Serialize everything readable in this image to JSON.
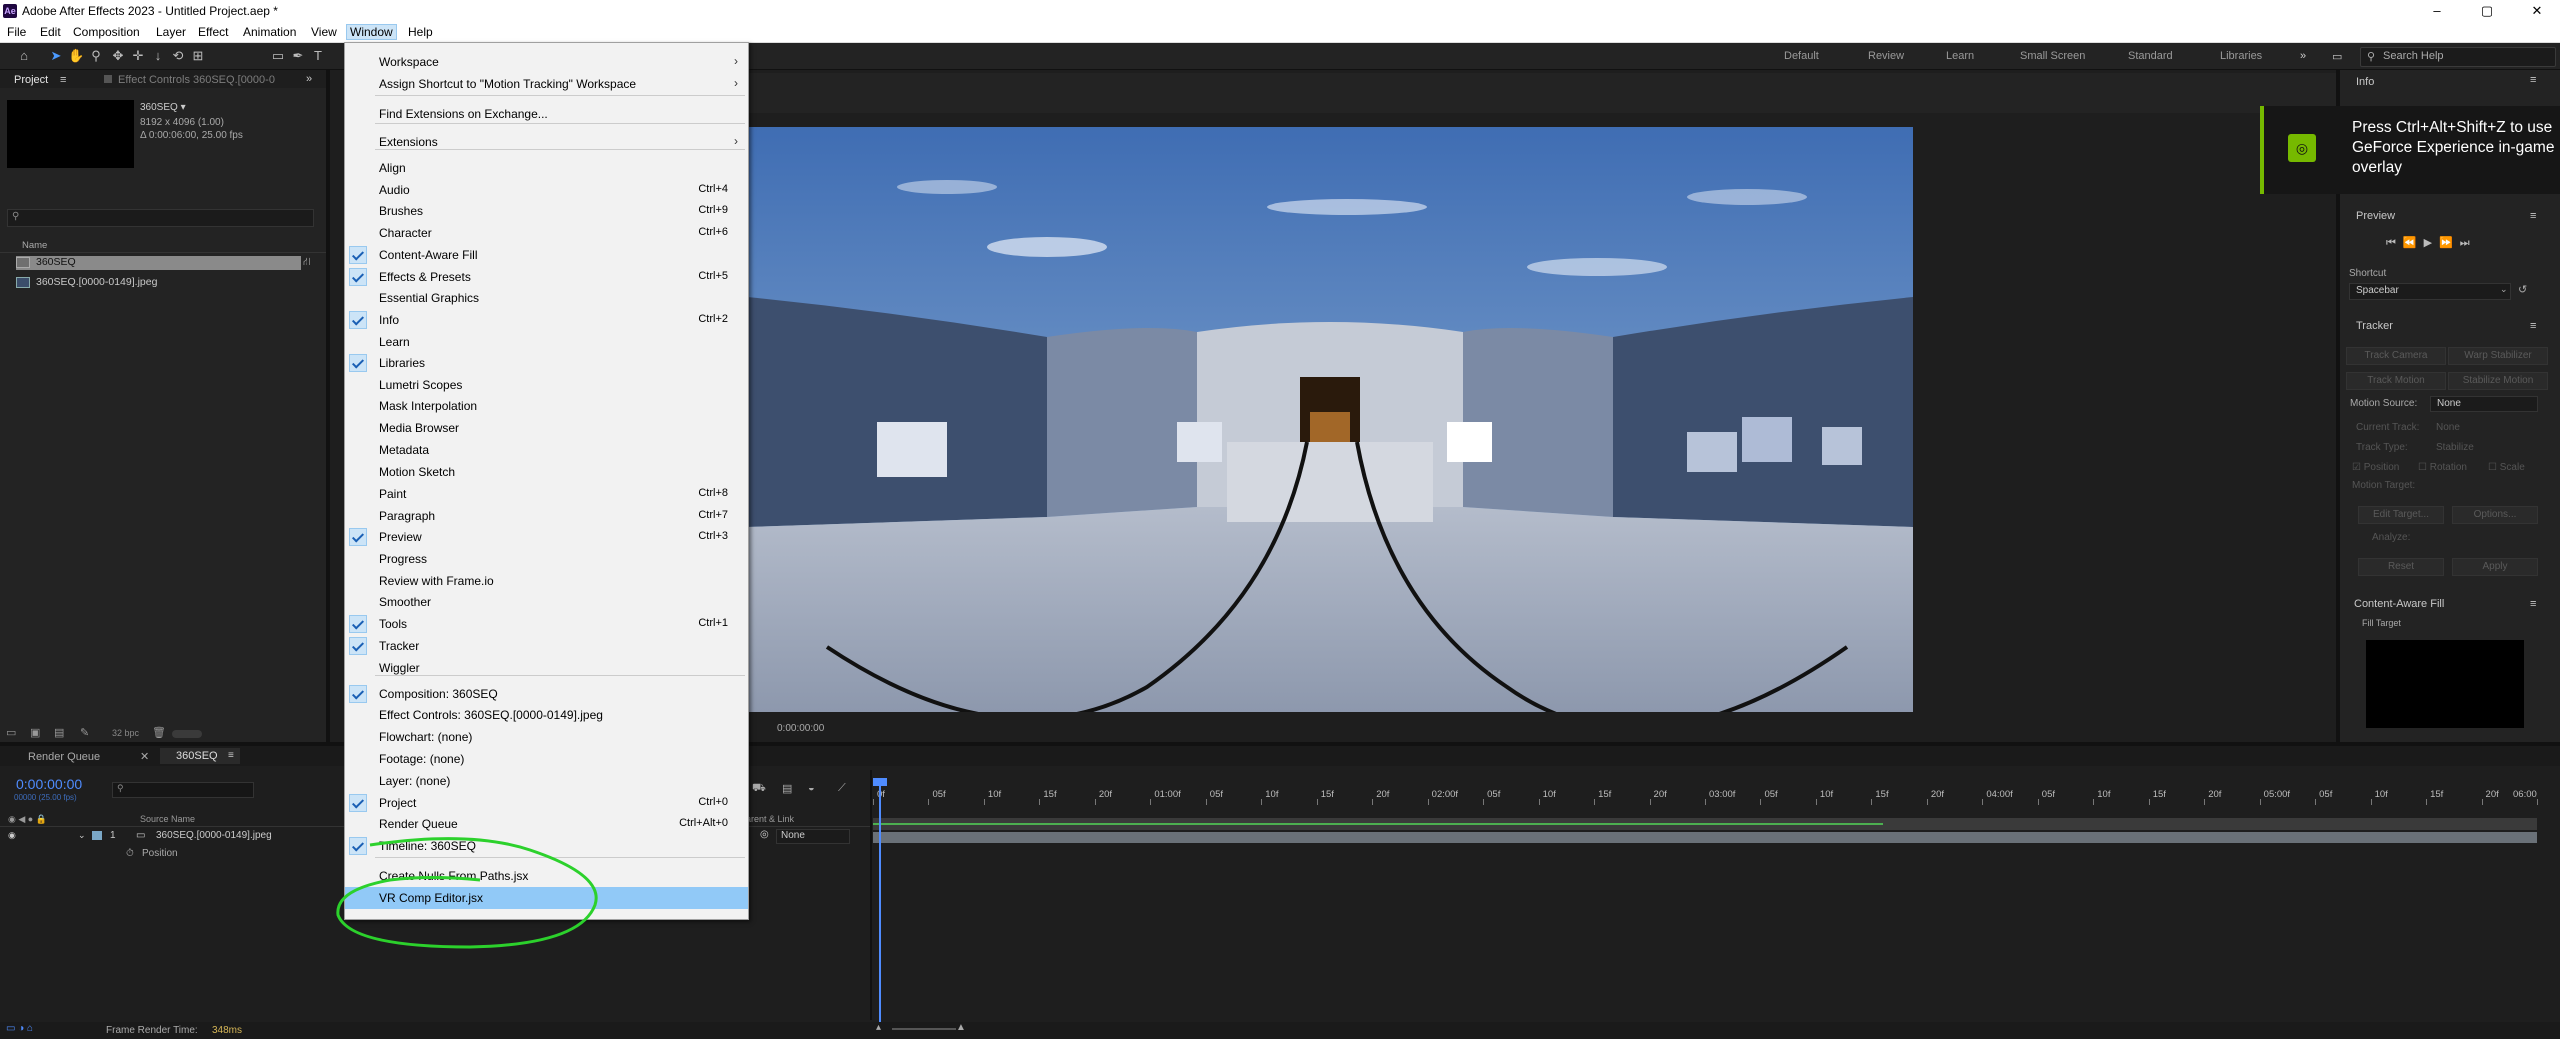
{
  "titlebar": {
    "title": "Adobe After Effects 2023 - Untitled Project.aep *",
    "app_icon": "Ae",
    "minimize": "–",
    "maximize": "▢",
    "close": "✕"
  },
  "menubar": {
    "items": [
      "File",
      "Edit",
      "Composition",
      "Layer",
      "Effect",
      "Animation",
      "View",
      "Window",
      "Help"
    ]
  },
  "workspaces": [
    "Default",
    "Review",
    "Learn",
    "Small Screen",
    "Standard",
    "Libraries"
  ],
  "search_help_placeholder": "Search Help",
  "project": {
    "tab": "Project",
    "effect_controls_tab": "Effect Controls 360SEQ.[0000-0",
    "comp_name": "360SEQ ▾",
    "dimensions": "8192 x 4096 (1.00)",
    "duration": "Δ 0:00:06:00, 25.00 fps",
    "col_name": "Name",
    "rows": [
      "360SEQ",
      "360SEQ.[0000-0149].jpeg"
    ],
    "bpc": "32 bpc"
  },
  "window_menu": {
    "items": [
      {
        "label": "Workspace",
        "shortcut": "",
        "checked": false,
        "submenu": true
      },
      {
        "label": "Assign Shortcut to \"Motion Tracking\" Workspace",
        "shortcut": "",
        "checked": false,
        "submenu": true
      },
      {
        "label": "Find Extensions on Exchange...",
        "shortcut": "",
        "checked": false,
        "submenu": false
      },
      {
        "label": "Extensions",
        "shortcut": "",
        "checked": false,
        "submenu": true
      },
      {
        "label": "Align",
        "shortcut": "",
        "checked": false
      },
      {
        "label": "Audio",
        "shortcut": "Ctrl+4",
        "checked": false
      },
      {
        "label": "Brushes",
        "shortcut": "Ctrl+9",
        "checked": false
      },
      {
        "label": "Character",
        "shortcut": "Ctrl+6",
        "checked": false
      },
      {
        "label": "Content-Aware Fill",
        "shortcut": "",
        "checked": true
      },
      {
        "label": "Effects & Presets",
        "shortcut": "Ctrl+5",
        "checked": true
      },
      {
        "label": "Essential Graphics",
        "shortcut": "",
        "checked": false
      },
      {
        "label": "Info",
        "shortcut": "Ctrl+2",
        "checked": true
      },
      {
        "label": "Learn",
        "shortcut": "",
        "checked": false
      },
      {
        "label": "Libraries",
        "shortcut": "",
        "checked": true
      },
      {
        "label": "Lumetri Scopes",
        "shortcut": "",
        "checked": false
      },
      {
        "label": "Mask Interpolation",
        "shortcut": "",
        "checked": false
      },
      {
        "label": "Media Browser",
        "shortcut": "",
        "checked": false
      },
      {
        "label": "Metadata",
        "shortcut": "",
        "checked": false
      },
      {
        "label": "Motion Sketch",
        "shortcut": "",
        "checked": false
      },
      {
        "label": "Paint",
        "shortcut": "Ctrl+8",
        "checked": false
      },
      {
        "label": "Paragraph",
        "shortcut": "Ctrl+7",
        "checked": false
      },
      {
        "label": "Preview",
        "shortcut": "Ctrl+3",
        "checked": true
      },
      {
        "label": "Progress",
        "shortcut": "",
        "checked": false
      },
      {
        "label": "Review with Frame.io",
        "shortcut": "",
        "checked": false
      },
      {
        "label": "Smoother",
        "shortcut": "",
        "checked": false
      },
      {
        "label": "Tools",
        "shortcut": "Ctrl+1",
        "checked": true
      },
      {
        "label": "Tracker",
        "shortcut": "",
        "checked": true
      },
      {
        "label": "Wiggler",
        "shortcut": "",
        "checked": false
      },
      {
        "label": "Composition: 360SEQ",
        "shortcut": "",
        "checked": true
      },
      {
        "label": "Effect Controls: 360SEQ.[0000-0149].jpeg",
        "shortcut": "",
        "checked": false
      },
      {
        "label": "Flowchart: (none)",
        "shortcut": "",
        "checked": false
      },
      {
        "label": "Footage: (none)",
        "shortcut": "",
        "checked": false
      },
      {
        "label": "Layer: (none)",
        "shortcut": "",
        "checked": false
      },
      {
        "label": "Project",
        "shortcut": "Ctrl+0",
        "checked": true
      },
      {
        "label": "Render Queue",
        "shortcut": "Ctrl+Alt+0",
        "checked": false
      },
      {
        "label": "Timeline: 360SEQ",
        "shortcut": "",
        "checked": true
      },
      {
        "label": "Create Nulls From Paths.jsx",
        "shortcut": "",
        "checked": false
      },
      {
        "label": "VR Comp Editor.jsx",
        "shortcut": "",
        "checked": false,
        "highlighted": true
      }
    ]
  },
  "viewer": {
    "timecode": "0:00:00:00"
  },
  "timeline": {
    "render_queue_tab": "Render Queue",
    "comp_tab": "360SEQ",
    "timecode": "0:00:00:00",
    "timecode_sub": "00000 (25.00 fps)",
    "col_source_name": "Source Name",
    "col_parent": "Parent & Link",
    "layer_index": "1",
    "layer_name": "360SEQ.[0000-0149].jpeg",
    "layer_parent": "None",
    "property": "Position",
    "ruler_labels": [
      "0f",
      "05f",
      "10f",
      "15f",
      "20f",
      "01:00f",
      "05f",
      "10f",
      "15f",
      "20f",
      "02:00f",
      "05f",
      "10f",
      "15f",
      "20f",
      "03:00f",
      "05f",
      "10f",
      "15f",
      "20f",
      "04:00f",
      "05f",
      "10f",
      "15f",
      "20f",
      "05:00f",
      "05f",
      "10f",
      "15f",
      "20f",
      "06:00"
    ],
    "frame_render_label": "Frame Render Time:",
    "frame_render_value": "348ms"
  },
  "right_panels": {
    "info": "Info",
    "nvidia_overlay": "Press Ctrl+Alt+Shift+Z to use GeForce Experience in-game overlay",
    "preview": "Preview",
    "shortcut_label": "Shortcut",
    "shortcut_value": "Spacebar",
    "tracker": "Tracker",
    "track_camera": "Track Camera",
    "warp_stabilizer": "Warp Stabilizer",
    "track_motion": "Track Motion",
    "stabilize_motion": "Stabilize Motion",
    "motion_source_label": "Motion Source:",
    "motion_source_value": "None",
    "current_track": "Current Track:",
    "current_track_value": "None",
    "track_type": "Track Type:",
    "track_type_value": "Stabilize",
    "position": "Position",
    "rotation": "Rotation",
    "scale": "Scale",
    "motion_target": "Motion Target:",
    "edit_target": "Edit Target...",
    "options": "Options...",
    "analyze": "Analyze:",
    "reset": "Reset",
    "apply": "Apply",
    "content_aware_fill": "Content-Aware Fill",
    "fill_target": "Fill Target"
  }
}
